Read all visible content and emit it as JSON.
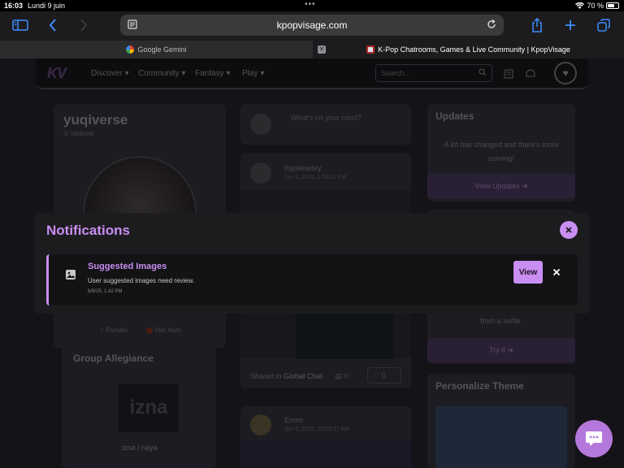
{
  "status_bar": {
    "time": "16:03",
    "date": "Lundi 9 juin",
    "battery": "70 %",
    "battery_level": 0.7,
    "icons": [
      "more-dots-icon",
      "wifi-icon",
      "battery-icon"
    ]
  },
  "browser": {
    "url": "kpopvisage.com",
    "icons": [
      "sidebar-icon",
      "back-icon",
      "forward-icon",
      "reader-icon",
      "reload-icon",
      "share-icon",
      "new-tab-icon",
      "tabs-icon"
    ],
    "tabs": [
      {
        "label": "Google Gemini",
        "active": false
      },
      {
        "label": "K-Pop Chatrooms, Games & Live Community | KpopVisage",
        "active": true
      }
    ]
  },
  "site": {
    "logo": "KV",
    "nav": [
      "Discover",
      "Community",
      "Fantasy",
      "Play"
    ],
    "search_placeholder": "Search...",
    "profile": {
      "username": "yuqiverse",
      "rank": "Idolized",
      "gender": "Female",
      "country": "Viet Nam",
      "group_allegiance_title": "Group Allegiance",
      "group_logo": "izna",
      "group_caption": "izna / naya"
    },
    "feed": {
      "compose_placeholder": "What's on your mind?",
      "post1": {
        "author": "itsjuliewifey",
        "time": "Jun 8, 2025, 1:33:51 PM"
      },
      "shared_in": "Shared in",
      "shared_room": "Global Chat",
      "comments": "0",
      "likes": "0",
      "post2": {
        "author": "Emmi",
        "time": "Jun 8, 2025, 10:03:27 AM"
      }
    },
    "right": {
      "updates_title": "Updates",
      "updates_text": "A lot has changed and there's more coming!",
      "updates_btn": "View Updates",
      "selfie_text": "from a selfie.",
      "try_btn": "Try it",
      "theme_title": "Personalize Theme"
    }
  },
  "modal": {
    "title": "Notifications",
    "notification": {
      "title": "Suggested Images",
      "description": "User suggested images need review.",
      "time": "6/9/25, 1:42 PM",
      "view_label": "View"
    }
  },
  "colors": {
    "accent": "#c98ef2",
    "fab": "#b478dc",
    "ios_blue": "#3d8cff"
  }
}
